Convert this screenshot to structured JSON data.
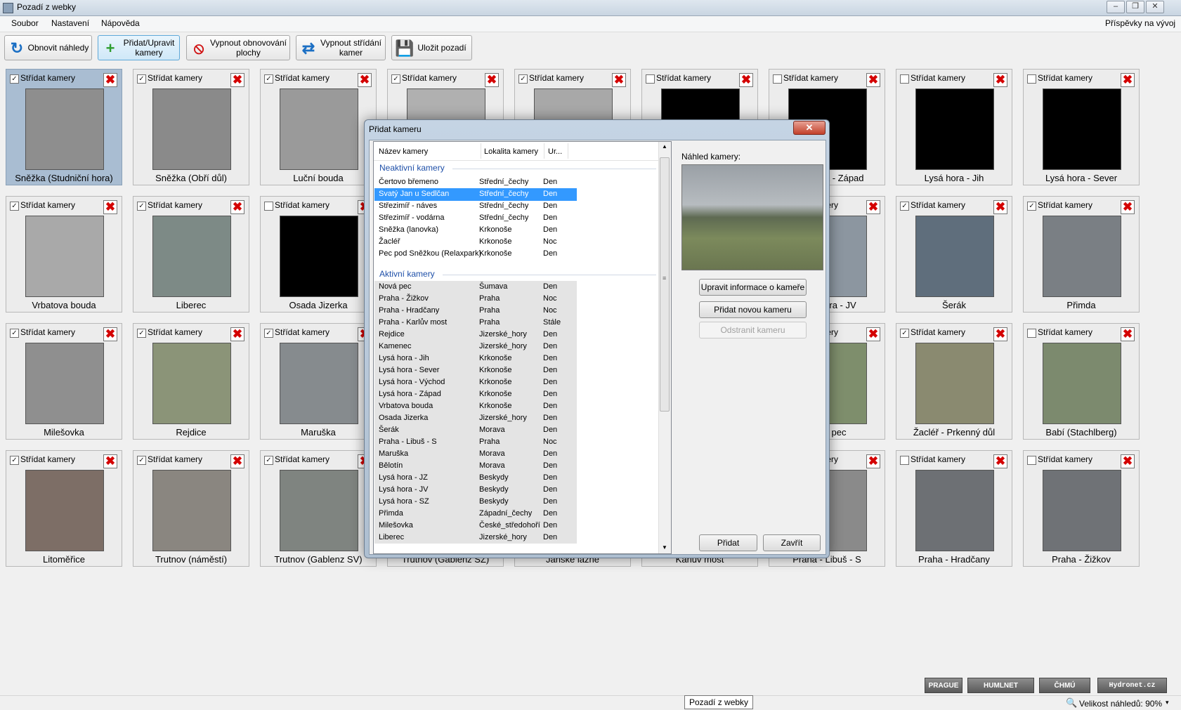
{
  "window": {
    "title": "Pozadí z webky"
  },
  "menu": {
    "items": [
      "Soubor",
      "Nastavení",
      "Nápověda"
    ],
    "right_link": "Příspěvky na vývoj"
  },
  "toolbar": {
    "refresh": "Obnovit náhledy",
    "add_edit": "Přidat/Upravit kamery",
    "disable_refresh": "Vypnout obnovování plochy",
    "disable_switch": "Vypnout střídání kamer",
    "save": "Uložit pozadí"
  },
  "tile_checkbox_label": "Střídat kamery",
  "tiles": [
    {
      "name": "Sněžka (Studniční hora)",
      "checked": true,
      "selected": true,
      "color": "#8e8e8e"
    },
    {
      "name": "Sněžka (Obří důl)",
      "checked": true,
      "color": "#8a8a8a"
    },
    {
      "name": "Luční bouda",
      "checked": true,
      "color": "#9a9a9a"
    },
    {
      "name": "",
      "checked": true,
      "color": "#b0b0b0"
    },
    {
      "name": "",
      "checked": true,
      "color": "#a8a8a8"
    },
    {
      "name": "",
      "checked": false,
      "color": "#000000"
    },
    {
      "name": "Lysá hora - Západ",
      "checked": false,
      "color": "#000000"
    },
    {
      "name": "Lysá hora - Jih",
      "checked": false,
      "color": "#000000"
    },
    {
      "name": "Lysá hora - Sever",
      "checked": false,
      "color": "#000000"
    },
    {
      "name": "Vrbatova bouda",
      "checked": true,
      "color": "#a9a9a9"
    },
    {
      "name": "Liberec",
      "checked": true,
      "color": "#7d8a86"
    },
    {
      "name": "Osada Jizerka",
      "checked": false,
      "color": "#000000"
    },
    {
      "name": "",
      "checked": true,
      "color": "#9c9c9c"
    },
    {
      "name": "",
      "checked": true,
      "color": "#9c9c9c"
    },
    {
      "name": "",
      "checked": true,
      "color": "#9c9c9c"
    },
    {
      "name": "Lysá hora - JV",
      "checked": true,
      "color": "#8c96a0"
    },
    {
      "name": "Šerák",
      "checked": true,
      "color": "#5f6e7c"
    },
    {
      "name": "Přimda",
      "checked": true,
      "color": "#7a7f84"
    },
    {
      "name": "Milešovka",
      "checked": true,
      "color": "#8f8f8f"
    },
    {
      "name": "Rejdice",
      "checked": true,
      "color": "#8b9478"
    },
    {
      "name": "Maruška",
      "checked": true,
      "color": "#868b8e"
    },
    {
      "name": "",
      "checked": true,
      "color": "#9c9c9c"
    },
    {
      "name": "",
      "checked": true,
      "color": "#9c9c9c"
    },
    {
      "name": "",
      "checked": true,
      "color": "#9c9c9c"
    },
    {
      "name": "Nová pec",
      "checked": true,
      "color": "#7e8e6c"
    },
    {
      "name": "Žacléř - Prkenný důl",
      "checked": true,
      "color": "#8a8a70"
    },
    {
      "name": "Babí (Stachlberg)",
      "checked": false,
      "color": "#7c8a6e"
    },
    {
      "name": "Litoměřice",
      "checked": true,
      "color": "#7d6e66"
    },
    {
      "name": "Trutnov (náměstí)",
      "checked": true,
      "color": "#8a8680"
    },
    {
      "name": "Trutnov (Gablenz SV)",
      "checked": true,
      "color": "#7f8480"
    },
    {
      "name": "Trutnov (Gablenz SZ)",
      "checked": true,
      "color": "#8a8a8a"
    },
    {
      "name": "Janské lázně",
      "checked": true,
      "color": "#8a8a8a"
    },
    {
      "name": "Karlův most",
      "checked": true,
      "color": "#8a8a8a"
    },
    {
      "name": "Praha - Libuš - S",
      "checked": true,
      "color": "#8a8a8a"
    },
    {
      "name": "Praha - Hradčany",
      "checked": false,
      "color": "#6d7074"
    },
    {
      "name": "Praha - Žižkov",
      "checked": false,
      "color": "#6f7276"
    }
  ],
  "dialog": {
    "title": "Přidat kameru",
    "close": "✕",
    "columns": [
      "Název kamery",
      "Lokalita kamery",
      "Ur..."
    ],
    "group_inactive": "Neaktivní kamery",
    "group_active": "Aktivní kamery",
    "inactive": [
      [
        "Čertovo břemeno",
        "Střední_čechy",
        "Den"
      ],
      [
        "Svatý Jan u Sedlčan",
        "Střední_čechy",
        "Den"
      ],
      [
        "Střezimíř - náves",
        "Střední_čechy",
        "Den"
      ],
      [
        "Střezimíř - vodárna",
        "Střední_čechy",
        "Den"
      ],
      [
        "Sněžka (lanovka)",
        "Krkonoše",
        "Den"
      ],
      [
        "Žacléř",
        "Krkonoše",
        "Noc"
      ],
      [
        "Pec pod Sněžkou (Relaxpark)",
        "Krkonoše",
        "Den"
      ]
    ],
    "active": [
      [
        "Nová pec",
        "Šumava",
        "Den"
      ],
      [
        "Praha - Žižkov",
        "Praha",
        "Noc"
      ],
      [
        "Praha - Hradčany",
        "Praha",
        "Noc"
      ],
      [
        "Praha - Karlův most",
        "Praha",
        "Stále"
      ],
      [
        "Rejdice",
        "Jizerské_hory",
        "Den"
      ],
      [
        "Kamenec",
        "Jizerské_hory",
        "Den"
      ],
      [
        "Lysá hora - Jih",
        "Krkonoše",
        "Den"
      ],
      [
        "Lysá hora - Sever",
        "Krkonoše",
        "Den"
      ],
      [
        "Lysá hora - Východ",
        "Krkonoše",
        "Den"
      ],
      [
        "Lysá hora - Západ",
        "Krkonoše",
        "Den"
      ],
      [
        "Vrbatova bouda",
        "Krkonoše",
        "Den"
      ],
      [
        "Osada Jizerka",
        "Jizerské_hory",
        "Den"
      ],
      [
        "Šerák",
        "Morava",
        "Den"
      ],
      [
        "Praha - Libuš - S",
        "Praha",
        "Noc"
      ],
      [
        "Maruška",
        "Morava",
        "Den"
      ],
      [
        "Bělotín",
        "Morava",
        "Den"
      ],
      [
        "Lysá hora - JZ",
        "Beskydy",
        "Den"
      ],
      [
        "Lysá hora - JV",
        "Beskydy",
        "Den"
      ],
      [
        "Lysá hora - SZ",
        "Beskydy",
        "Den"
      ],
      [
        "Přimda",
        "Západní_čechy",
        "Den"
      ],
      [
        "Milešovka",
        "České_středohoří",
        "Den"
      ],
      [
        "Liberec",
        "Jizerské_hory",
        "Den"
      ]
    ],
    "preview_label": "Náhled kamery:",
    "btn_edit": "Upravit informace o kameře",
    "btn_new": "Přidat novou kameru",
    "btn_remove": "Odstranit kameru",
    "btn_add": "Přidat",
    "btn_close": "Zavřít"
  },
  "taskbar_tooltip": "Pozadí z webky",
  "status": {
    "zoom": "Velikost náhledů: 90%"
  },
  "logos": [
    "PRAGUE WELCOME",
    "HUMLNET",
    "ČHMÚ",
    "Hydronet.cz"
  ]
}
